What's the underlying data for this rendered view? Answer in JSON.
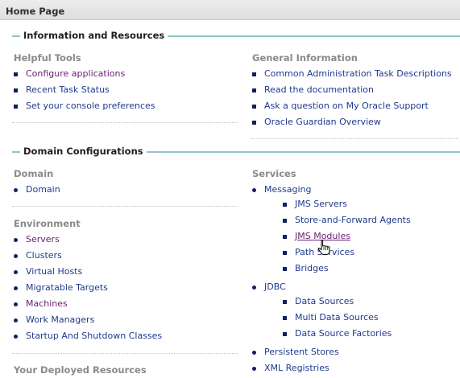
{
  "page": {
    "title": "Home Page"
  },
  "sections": {
    "info": {
      "title": "Information and Resources"
    },
    "domain_config": {
      "title": "Domain Configurations"
    }
  },
  "helpful_tools": {
    "title": "Helpful Tools",
    "items": [
      "Configure applications",
      "Recent Task Status",
      "Set your console preferences"
    ]
  },
  "general_info": {
    "title": "General Information",
    "items": [
      "Common Administration Task Descriptions",
      "Read the documentation",
      "Ask a question on My Oracle Support",
      "Oracle Guardian Overview"
    ]
  },
  "domain": {
    "title": "Domain",
    "items": [
      "Domain"
    ]
  },
  "environment": {
    "title": "Environment",
    "items": [
      "Servers",
      "Clusters",
      "Virtual Hosts",
      "Migratable Targets",
      "Machines",
      "Work Managers",
      "Startup And Shutdown Classes"
    ]
  },
  "deployed": {
    "title": "Your Deployed Resources"
  },
  "services": {
    "title": "Services",
    "messaging": {
      "label": "Messaging",
      "items": [
        "JMS Servers",
        "Store-and-Forward Agents",
        "JMS Modules",
        "Path Services",
        "Bridges"
      ]
    },
    "jdbc": {
      "label": "JDBC",
      "items": [
        "Data Sources",
        "Multi Data Sources",
        "Data Source Factories"
      ]
    },
    "persistent_stores": "Persistent Stores",
    "xml_registries": "XML Registries"
  },
  "colors": {
    "link": "#1f3a8f",
    "visited": "#6b1b71",
    "section_rule": "#8ec6c8",
    "group_title": "#8a8a8a"
  },
  "cursor": {
    "icon": "hand-pointer-icon"
  }
}
